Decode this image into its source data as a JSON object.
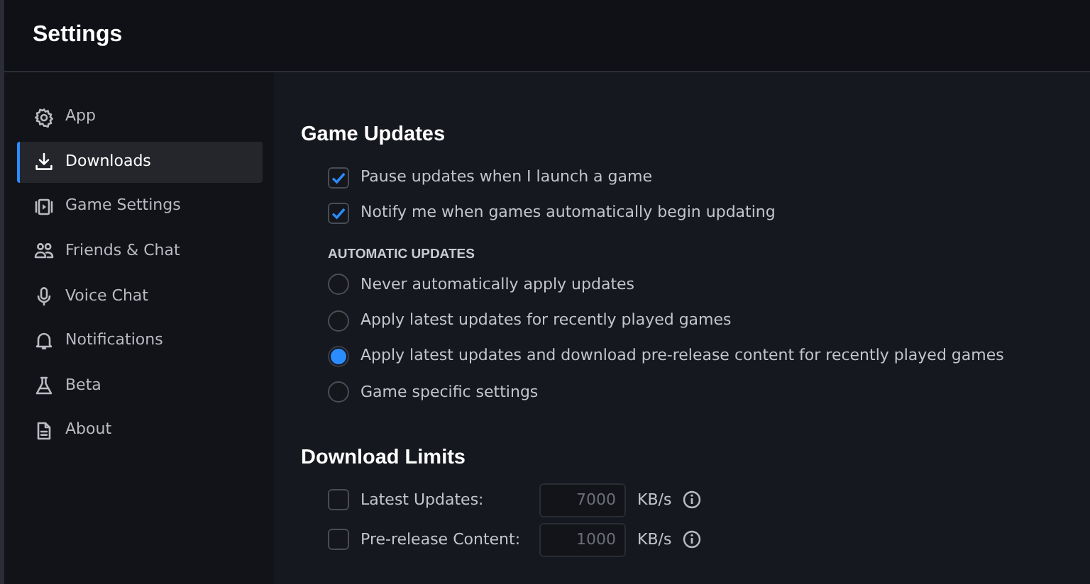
{
  "window": {
    "title": "Settings"
  },
  "sidebar": {
    "items": [
      {
        "label": "App",
        "selected": false
      },
      {
        "label": "Downloads",
        "selected": true
      },
      {
        "label": "Game Settings",
        "selected": false
      },
      {
        "label": "Friends & Chat",
        "selected": false
      },
      {
        "label": "Voice Chat",
        "selected": false
      },
      {
        "label": "Notifications",
        "selected": false
      },
      {
        "label": "Beta",
        "selected": false
      },
      {
        "label": "About",
        "selected": false
      }
    ]
  },
  "game_updates": {
    "title": "Game Updates",
    "options": [
      {
        "label": "Pause updates when I launch a game",
        "checked": true
      },
      {
        "label": "Notify me when games automatically begin updating",
        "checked": true
      }
    ],
    "automatic_updates": {
      "title": "AUTOMATIC UPDATES",
      "choices": [
        {
          "label": "Never automatically apply updates",
          "selected": false
        },
        {
          "label": "Apply latest updates for recently played games",
          "selected": false
        },
        {
          "label": "Apply latest updates and download pre-release content for recently played games",
          "selected": true
        },
        {
          "label": "Game specific settings",
          "selected": false
        }
      ]
    }
  },
  "download_limits": {
    "title": "Download Limits",
    "rows": [
      {
        "label": "Latest Updates:",
        "checked": false,
        "value": "7000",
        "unit": "KB/s"
      },
      {
        "label": "Pre-release Content:",
        "checked": false,
        "value": "1000",
        "unit": "KB/s"
      }
    ]
  }
}
